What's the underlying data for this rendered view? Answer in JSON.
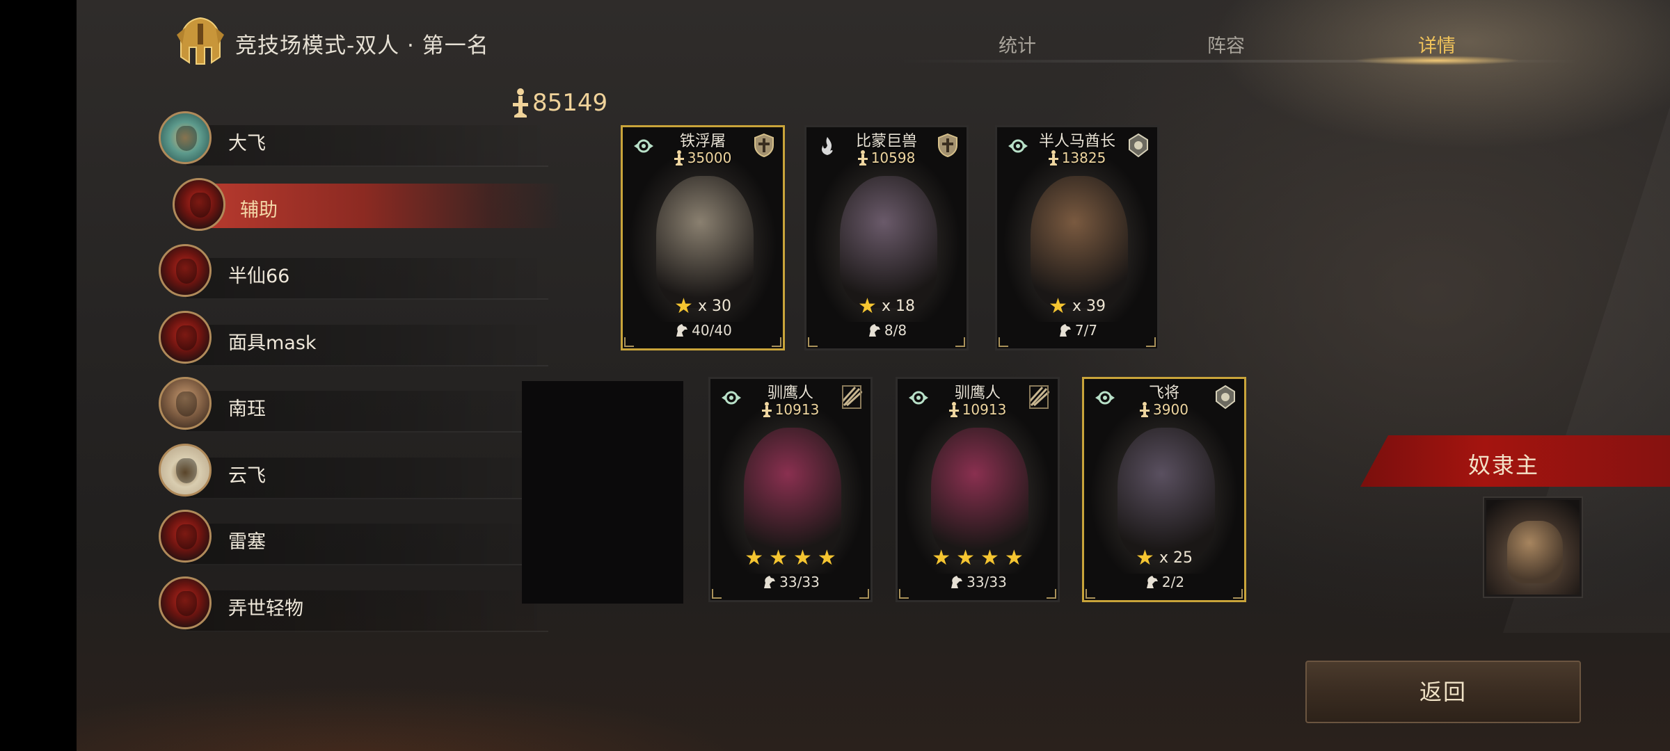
{
  "header": {
    "title": "竞技场模式-双人 · 第一名",
    "logo_icon": "golden-helmet-icon"
  },
  "tabs": [
    {
      "label": "统计",
      "active": false
    },
    {
      "label": "阵容",
      "active": false
    },
    {
      "label": "详情",
      "active": true
    }
  ],
  "players": [
    {
      "name": "大飞",
      "avatar": "teal",
      "selected": false
    },
    {
      "name": "辅助",
      "avatar": "demon",
      "selected": true
    },
    {
      "name": "半仙66",
      "avatar": "demon",
      "selected": false
    },
    {
      "name": "面具mask",
      "avatar": "demon",
      "selected": false
    },
    {
      "name": "南珏",
      "avatar": "beard",
      "selected": false
    },
    {
      "name": "云飞",
      "avatar": "rider",
      "selected": false
    },
    {
      "name": "雷塞",
      "avatar": "demon",
      "selected": false
    },
    {
      "name": "弄世轻物",
      "avatar": "demon",
      "selected": false
    }
  ],
  "total_power": "85149",
  "units_top": [
    {
      "name": "铁浮屠",
      "power": "35000",
      "stars": "x 30",
      "count": "40/40",
      "gold": true,
      "left_badge": "skill-gear-icon",
      "right_badge": "shield-class-icon",
      "art": "#8a8070"
    },
    {
      "name": "比蒙巨兽",
      "power": "10598",
      "stars": "x 18",
      "count": "8/8",
      "gold": false,
      "left_badge": "flame-icon",
      "right_badge": "shield-class-icon",
      "art": "#6a5a6a"
    },
    {
      "name": "半人马酋长",
      "power": "13825",
      "stars": "x 39",
      "count": "7/7",
      "gold": false,
      "left_badge": "skill-gear-icon",
      "right_badge": "commander-class-icon",
      "art": "#7a5a40"
    }
  ],
  "units_bottom": [
    {
      "name": "驯鹰人",
      "power": "10913",
      "star_count": 4,
      "count": "33/33",
      "gold": false,
      "left_badge": "skill-gear-icon",
      "right_badge": "ranged-class-icon",
      "art": "#8a3050"
    },
    {
      "name": "驯鹰人",
      "power": "10913",
      "star_count": 4,
      "count": "33/33",
      "gold": false,
      "left_badge": "skill-gear-icon",
      "right_badge": "ranged-class-icon",
      "art": "#8a3050"
    },
    {
      "name": "飞将",
      "power": "3900",
      "stars": "x 25",
      "count": "2/2",
      "gold": true,
      "left_badge": "skill-gear-icon",
      "right_badge": "commander-class-icon",
      "art": "#5a5060"
    }
  ],
  "hero": {
    "label": "奴隶主",
    "portrait_icon": "slave-master-portrait"
  },
  "back_button": "返回",
  "colors": {
    "accent_gold": "#f0c35a",
    "selected_red": "#b83a2e",
    "ribbon_red": "#a4140f"
  }
}
